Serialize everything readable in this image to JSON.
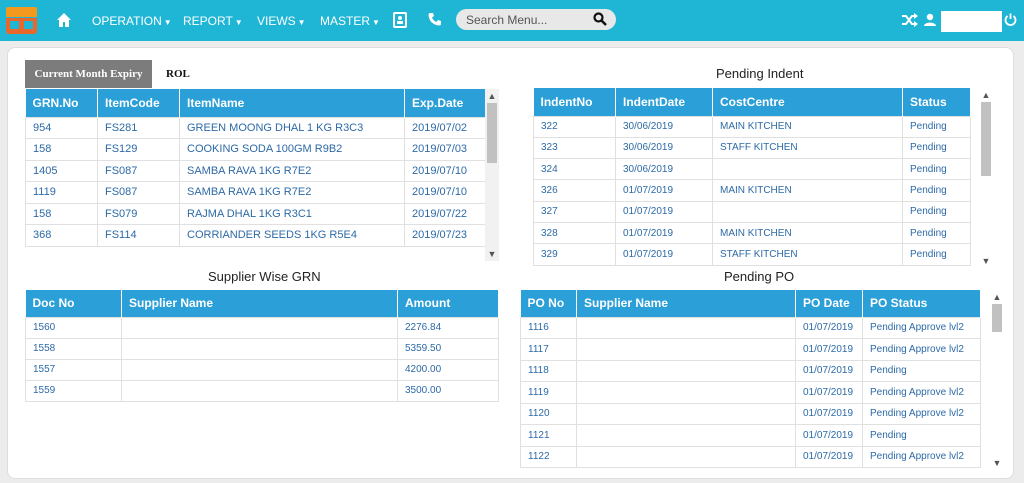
{
  "header": {
    "nav": [
      {
        "id": "operation",
        "label": "OPERATION"
      },
      {
        "id": "report",
        "label": "REPORT"
      },
      {
        "id": "views",
        "label": "VIEWS"
      },
      {
        "id": "master",
        "label": "MASTER"
      }
    ],
    "search_placeholder": "Search Menu...",
    "accent": "#1fb6d6"
  },
  "expiry": {
    "tabs": [
      "Current Month Expiry",
      "ROL"
    ],
    "columns": [
      "GRN.No",
      "ItemCode",
      "ItemName",
      "Exp.Date"
    ],
    "rows": [
      [
        "954",
        "FS281",
        "GREEN MOONG DHAL 1 KG R3C3",
        "2019/07/02"
      ],
      [
        "158",
        "FS129",
        "COOKING SODA 100GM R9B2",
        "2019/07/03"
      ],
      [
        "1405",
        "FS087",
        "SAMBA RAVA 1KG R7E2",
        "2019/07/10"
      ],
      [
        "1119",
        "FS087",
        "SAMBA RAVA 1KG R7E2",
        "2019/07/10"
      ],
      [
        "158",
        "FS079",
        "RAJMA DHAL 1KG R3C1",
        "2019/07/22"
      ],
      [
        "368",
        "FS114",
        "CORRIANDER SEEDS 1KG R5E4",
        "2019/07/23"
      ]
    ]
  },
  "pending_indent": {
    "title": "Pending Indent",
    "columns": [
      "IndentNo",
      "IndentDate",
      "CostCentre",
      "Status"
    ],
    "rows": [
      [
        "322",
        "30/06/2019",
        "MAIN KITCHEN",
        "Pending"
      ],
      [
        "323",
        "30/06/2019",
        "STAFF KITCHEN",
        "Pending"
      ],
      [
        "324",
        "30/06/2019",
        "",
        "Pending"
      ],
      [
        "326",
        "01/07/2019",
        "MAIN KITCHEN",
        "Pending"
      ],
      [
        "327",
        "01/07/2019",
        "",
        "Pending"
      ],
      [
        "328",
        "01/07/2019",
        "MAIN KITCHEN",
        "Pending"
      ],
      [
        "329",
        "01/07/2019",
        "STAFF KITCHEN",
        "Pending"
      ]
    ]
  },
  "supplier_grn": {
    "title": "Supplier Wise GRN",
    "columns": [
      "Doc No",
      "Supplier Name",
      "Amount"
    ],
    "rows": [
      [
        "1560",
        "",
        "2276.84"
      ],
      [
        "1558",
        "",
        "5359.50"
      ],
      [
        "1557",
        "",
        "4200.00"
      ],
      [
        "1559",
        "",
        "3500.00"
      ]
    ]
  },
  "pending_po": {
    "title": "Pending PO",
    "columns": [
      "PO No",
      "Supplier Name",
      "PO Date",
      "PO Status"
    ],
    "rows": [
      [
        "1116",
        "",
        "01/07/2019",
        "Pending Approve lvl2"
      ],
      [
        "1117",
        "",
        "01/07/2019",
        "Pending Approve lvl2"
      ],
      [
        "1118",
        "",
        "01/07/2019",
        "Pending"
      ],
      [
        "1119",
        "",
        "01/07/2019",
        "Pending Approve lvl2"
      ],
      [
        "1120",
        "",
        "01/07/2019",
        "Pending Approve lvl2"
      ],
      [
        "1121",
        "",
        "01/07/2019",
        "Pending"
      ],
      [
        "1122",
        "",
        "01/07/2019",
        "Pending Approve lvl2"
      ]
    ]
  }
}
